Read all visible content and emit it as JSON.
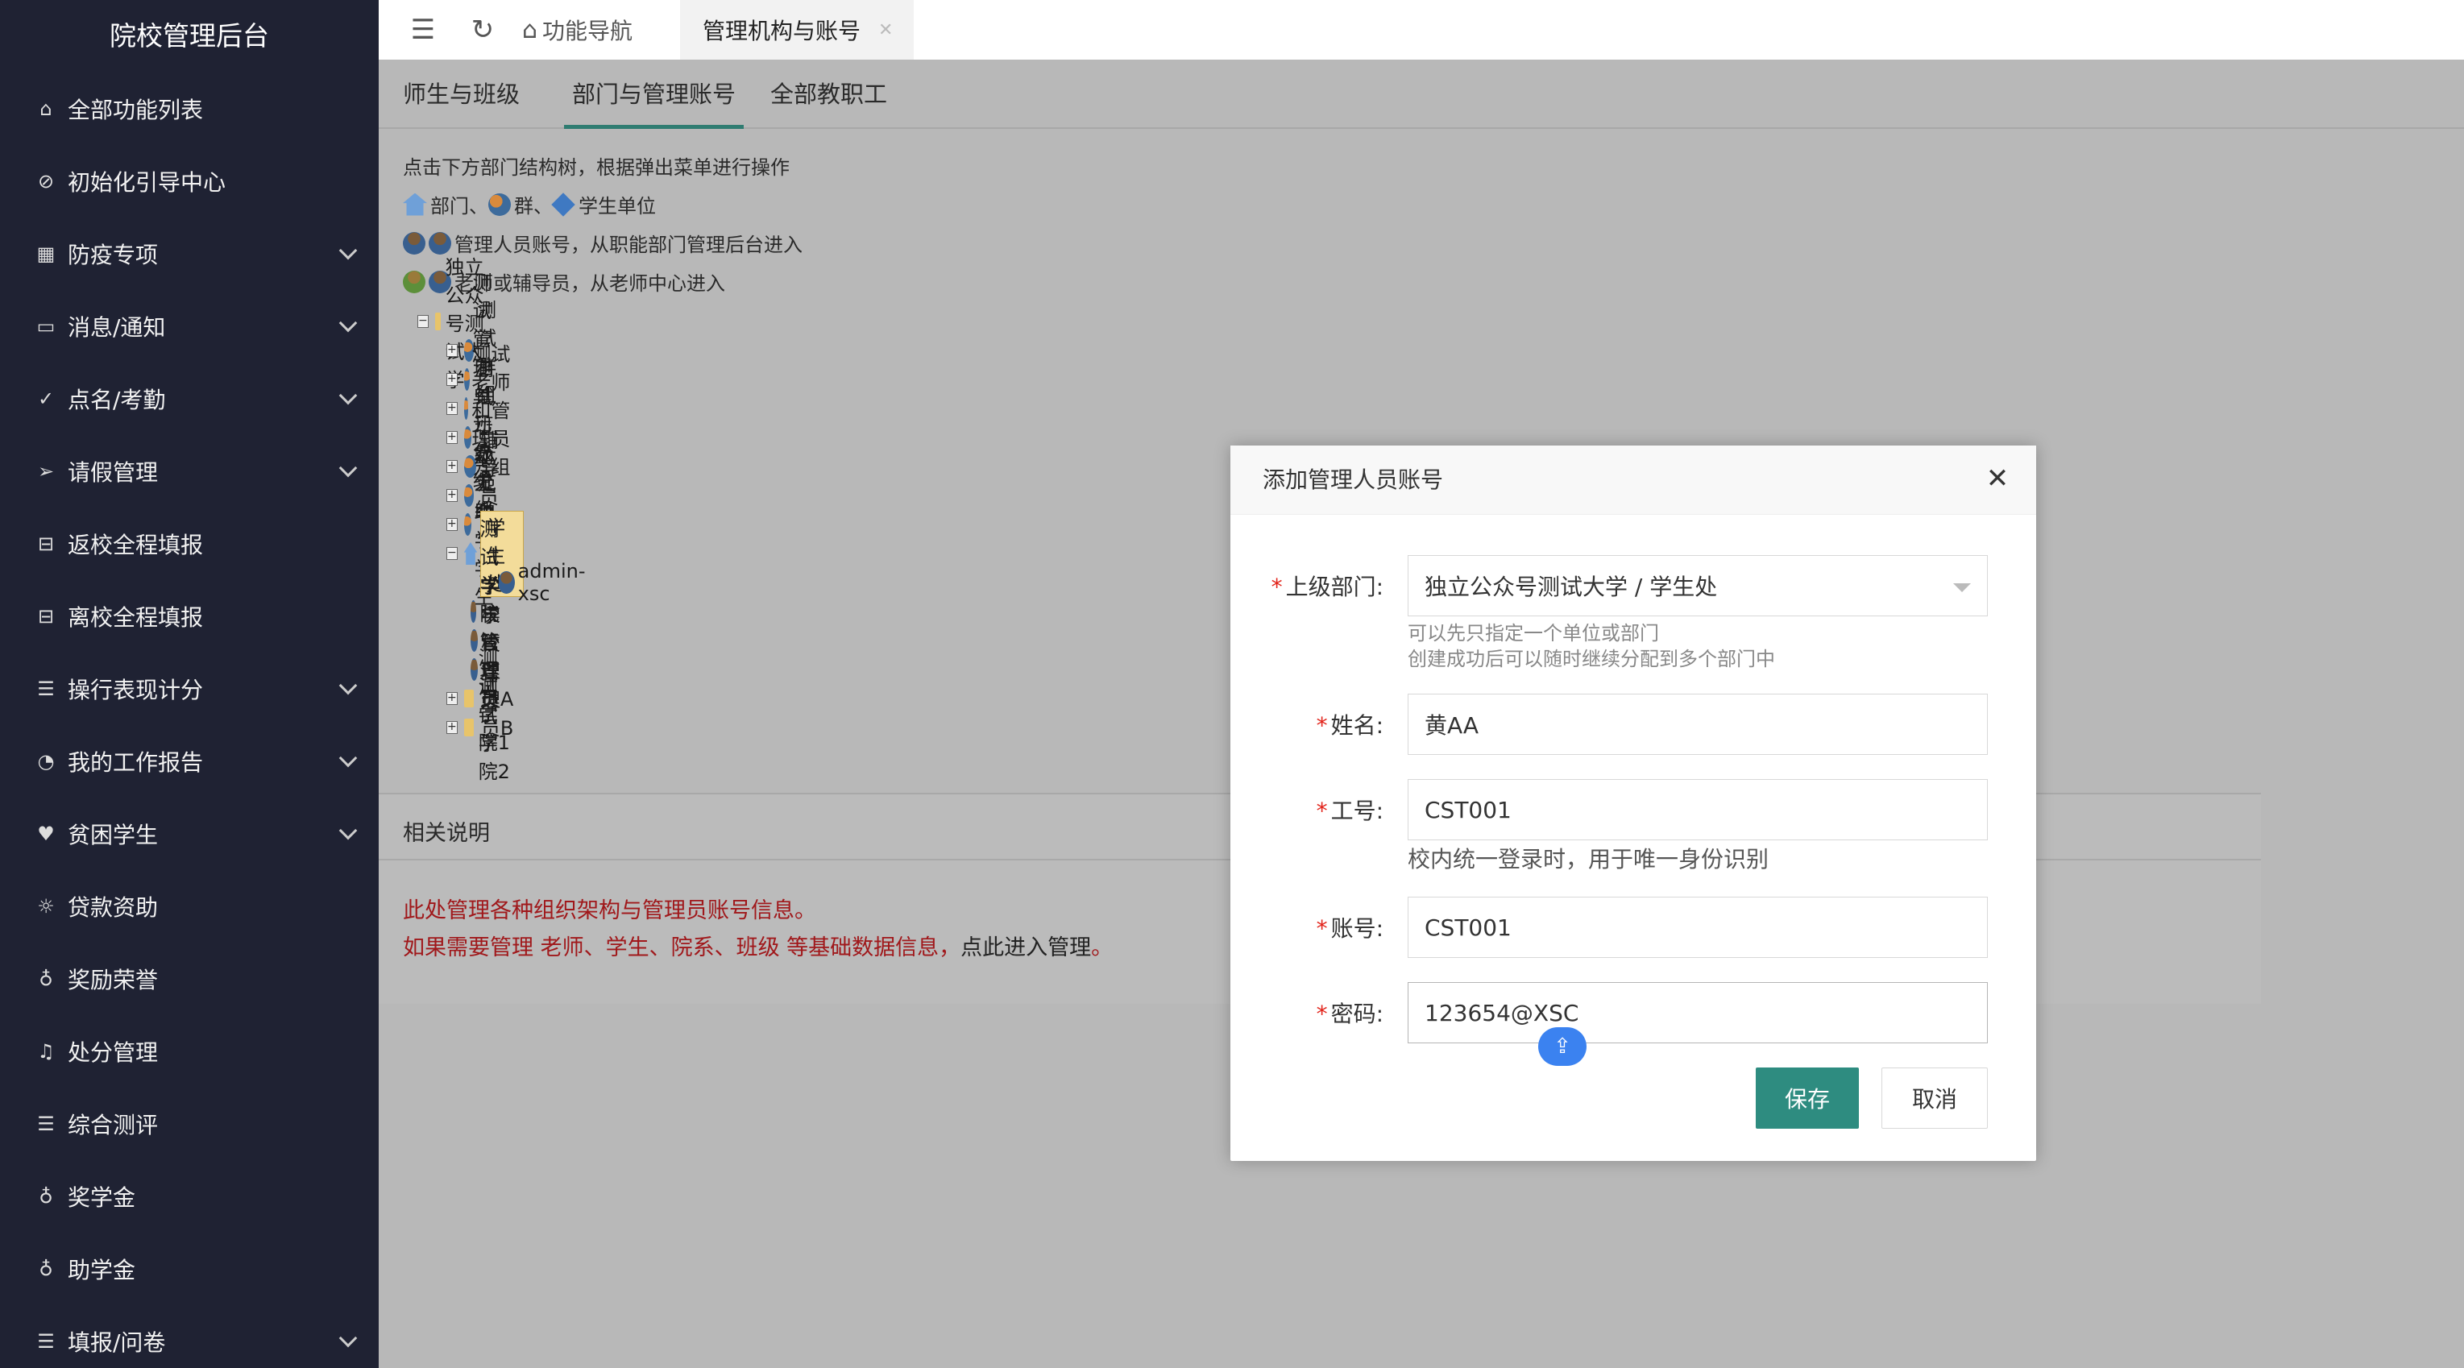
{
  "sidebar": {
    "title": "院校管理后台",
    "items": [
      {
        "label": "全部功能列表",
        "icon": "home-icon",
        "glyph": "⌂",
        "expandable": false
      },
      {
        "label": "初始化引导中心",
        "icon": "compass-icon",
        "glyph": "⊘",
        "expandable": false
      },
      {
        "label": "防疫专项",
        "icon": "calendar-icon",
        "glyph": "▦",
        "expandable": true
      },
      {
        "label": "消息/通知",
        "icon": "message-icon",
        "glyph": "▭",
        "expandable": true
      },
      {
        "label": "点名/考勤",
        "icon": "check-circle-icon",
        "glyph": "✓",
        "expandable": true
      },
      {
        "label": "请假管理",
        "icon": "send-icon",
        "glyph": "➢",
        "expandable": true
      },
      {
        "label": "返校全程填报",
        "icon": "book-icon",
        "glyph": "⊟",
        "expandable": false
      },
      {
        "label": "离校全程填报",
        "icon": "book-icon",
        "glyph": "⊟",
        "expandable": false
      },
      {
        "label": "操行表现计分",
        "icon": "list-icon",
        "glyph": "☰",
        "expandable": true
      },
      {
        "label": "我的工作报告",
        "icon": "pie-chart-icon",
        "glyph": "◔",
        "expandable": true
      },
      {
        "label": "贫困学生",
        "icon": "heart-icon",
        "glyph": "♥",
        "expandable": true
      },
      {
        "label": "贷款资助",
        "icon": "sun-icon",
        "glyph": "☼",
        "expandable": false
      },
      {
        "label": "奖励荣誉",
        "icon": "award-icon",
        "glyph": "♁",
        "expandable": false
      },
      {
        "label": "处分管理",
        "icon": "bell-icon",
        "glyph": "♫",
        "expandable": false
      },
      {
        "label": "综合测评",
        "icon": "sliders-icon",
        "glyph": "☰",
        "expandable": false
      },
      {
        "label": "奖学金",
        "icon": "award-icon",
        "glyph": "♁",
        "expandable": false
      },
      {
        "label": "助学金",
        "icon": "award-icon",
        "glyph": "♁",
        "expandable": false
      },
      {
        "label": "填报/问卷",
        "icon": "list-icon",
        "glyph": "☰",
        "expandable": true
      }
    ]
  },
  "topbar": {
    "home_tab": "功能导航",
    "active_tab": "管理机构与账号"
  },
  "subtabs": [
    "师生与班级",
    "部门与管理账号",
    "全部教职工"
  ],
  "help": {
    "line1": "点击下方部门结构树，根据弹出菜单进行操作",
    "line2_a": "部门、",
    "line2_b": "群、",
    "line2_c": "学生单位",
    "line3": "管理人员账号，从职能部门管理后台进入",
    "line4": "老师或辅导员，从老师中心进入"
  },
  "tree": {
    "root": "独立公众号测试大学",
    "groups": [
      "测试群组",
      "测试管理单元分组",
      "测试老师和管理员分组",
      "测试班级分组",
      "辅导员",
      "示范单位",
      "勤工助学学生"
    ],
    "selected": "学生处",
    "selected_child": "admin-xsc",
    "persons": [
      "测试学院管理员",
      "学校管理员A",
      "学校管理员B"
    ],
    "folders": [
      "测试学院1",
      "测试学院2"
    ]
  },
  "notes": {
    "title": "相关说明",
    "line1": "此处管理各种组织架构与管理员账号信息。",
    "line2_red": "如果需要管理 老师、学生、院系、班级 等基础数据信息，",
    "line2_dark": "点此进入管理",
    "line2_end": "。"
  },
  "modal": {
    "title": "添加管理人员账号",
    "dept_label": "上级部门:",
    "dept_value": "独立公众号测试大学 / 学生处",
    "dept_hint1": "可以先只指定一个单位或部门",
    "dept_hint2": "创建成功后可以随时继续分配到多个部门中",
    "name_label": "姓名:",
    "name_value": "黄AA",
    "empno_label": "工号:",
    "empno_value": "CST001",
    "empno_hint": "校内统一登录时，用于唯一身份识别",
    "account_label": "账号:",
    "account_value": "CST001",
    "password_label": "密码:",
    "password_value": "123654@XSC",
    "save": "保存",
    "cancel": "取消"
  }
}
